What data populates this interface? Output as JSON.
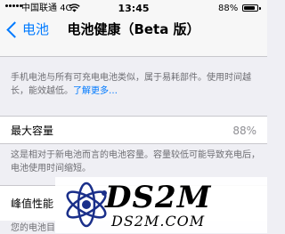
{
  "status_bar": {
    "carrier": "中国联通",
    "network": "4G",
    "time": "13:45",
    "battery_percent": "88%",
    "battery_level": 0.88
  },
  "nav": {
    "back_label": "电池",
    "title": "电池健康（Beta 版）"
  },
  "intro": {
    "text": "手机电池与所有可充电电池类似，属于易耗部件。使用时间越长，能效越低。",
    "link": "了解更多…"
  },
  "max_capacity": {
    "label": "最大容量",
    "value": "88%"
  },
  "capacity_footer": "这是相对于新电池而言的电池容量。容量较低可能导致充电后，电池使用时间缩短。",
  "peak_performance": {
    "label": "峰值性能",
    "footer": "您的电池目"
  },
  "watermark": {
    "brand": "DS2M",
    "url": "DS2M.COM"
  },
  "colors": {
    "accent": "#007aff",
    "background": "#efeff4",
    "secondary_text": "#6d6d72"
  }
}
